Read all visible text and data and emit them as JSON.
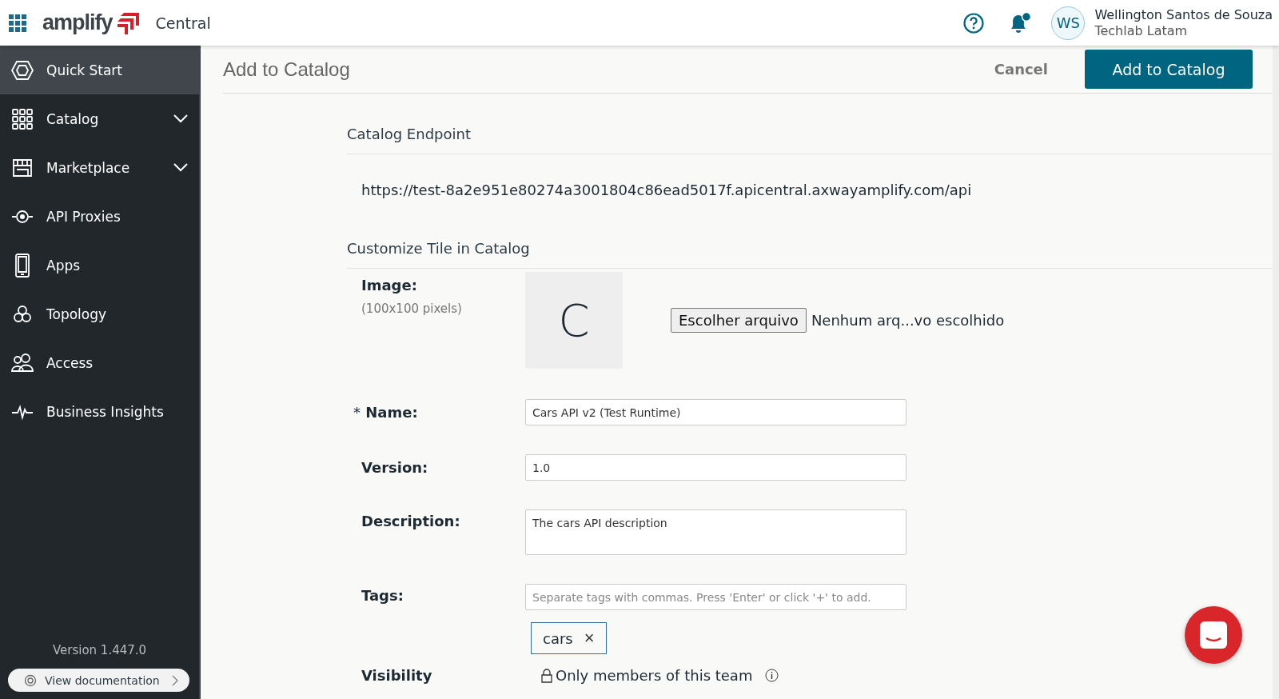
{
  "header": {
    "logo_text": "amplify",
    "product": "Central",
    "user": {
      "initials": "WS",
      "name": "Wellington Santos de Souza",
      "org": "Techlab Latam"
    },
    "notifications": {
      "unread": true
    }
  },
  "sidebar": {
    "items": [
      {
        "label": "Quick Start",
        "selected": true,
        "kind": "link"
      },
      {
        "label": "Catalog",
        "selected": false,
        "kind": "group"
      },
      {
        "label": "Marketplace",
        "selected": false,
        "kind": "group"
      },
      {
        "label": "API Proxies",
        "selected": false,
        "kind": "link"
      },
      {
        "label": "Apps",
        "selected": false,
        "kind": "link"
      },
      {
        "label": "Topology",
        "selected": false,
        "kind": "link"
      },
      {
        "label": "Access",
        "selected": false,
        "kind": "link"
      },
      {
        "label": "Business Insights",
        "selected": false,
        "kind": "link"
      }
    ],
    "version": "Version 1.447.0",
    "docs_link": "View documentation"
  },
  "page": {
    "title": "Add to Catalog",
    "cancel": "Cancel",
    "submit": "Add to Catalog"
  },
  "endpoint": {
    "heading": "Catalog Endpoint",
    "url": "https://test-8a2e951e80274a3001804c86ead5017f.apicentral.axwayamplify.com/api"
  },
  "customize": {
    "heading": "Customize Tile in Catalog",
    "fields": [
      {
        "kind": "image",
        "label": "Image:",
        "hint": "(100x100 pixels)",
        "preview": "C",
        "file_button": "Escolher arquivo",
        "file_status": "Nenhum arq...vo escolhido"
      },
      {
        "kind": "text",
        "marker": "*",
        "label": "Name:",
        "value": "Cars API v2 (Test Runtime)"
      },
      {
        "kind": "text",
        "label": "Version:",
        "value": "1.0"
      },
      {
        "kind": "textarea",
        "label": "Description:",
        "value": "The cars API description"
      },
      {
        "kind": "tags",
        "label": "Tags:",
        "placeholder": "Separate tags with commas. Press 'Enter' or click '+' to add.",
        "tags": [
          "cars"
        ],
        "remove": "×"
      },
      {
        "kind": "visibility",
        "label": "Visibility",
        "value": "Only members of this team"
      }
    ]
  }
}
